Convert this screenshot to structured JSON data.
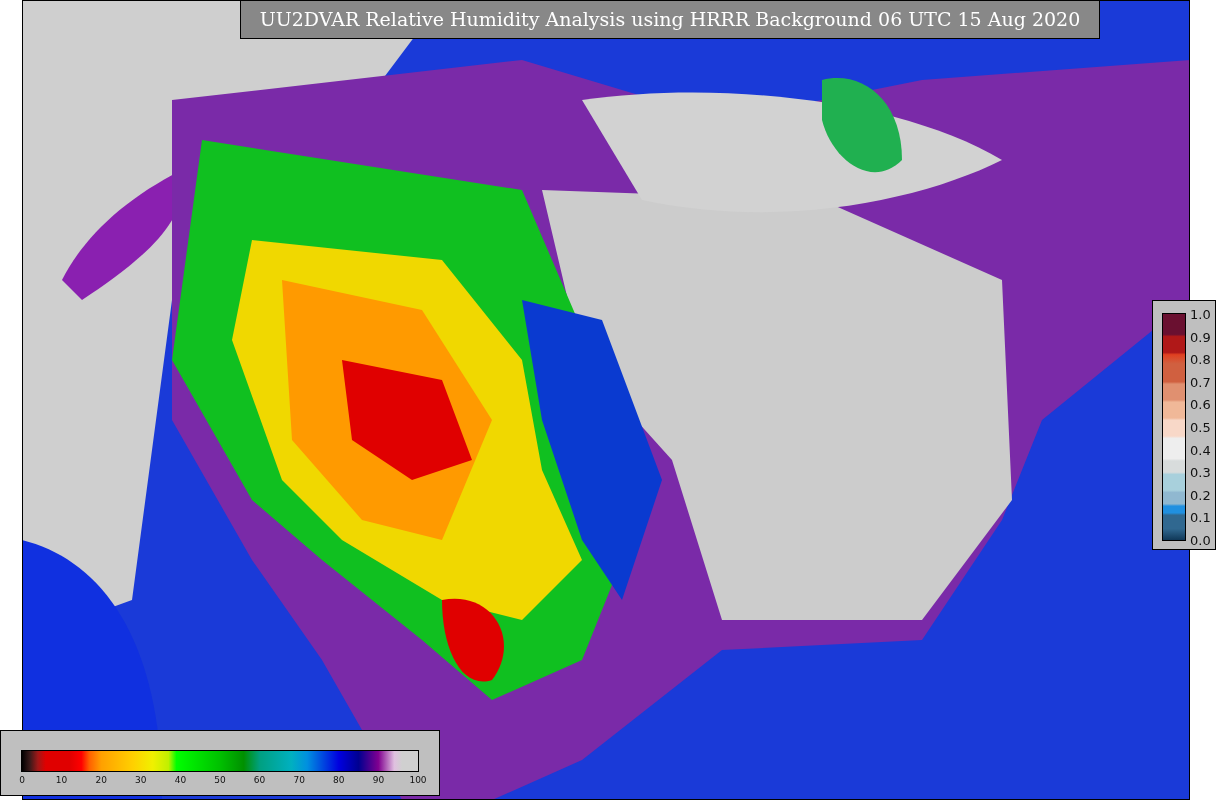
{
  "title": "UU2DVAR Relative Humidity Analysis using HRRR Background 06 UTC 15 Aug 2020",
  "humidity_scale": {
    "ticks": [
      "0",
      "10",
      "20",
      "30",
      "40",
      "50",
      "60",
      "70",
      "80",
      "90",
      "100"
    ]
  },
  "ratio_scale": {
    "ticks": [
      "1.0",
      "0.9",
      "0.8",
      "0.7",
      "0.6",
      "0.5",
      "0.4",
      "0.3",
      "0.2",
      "0.1",
      "0.0"
    ]
  }
}
